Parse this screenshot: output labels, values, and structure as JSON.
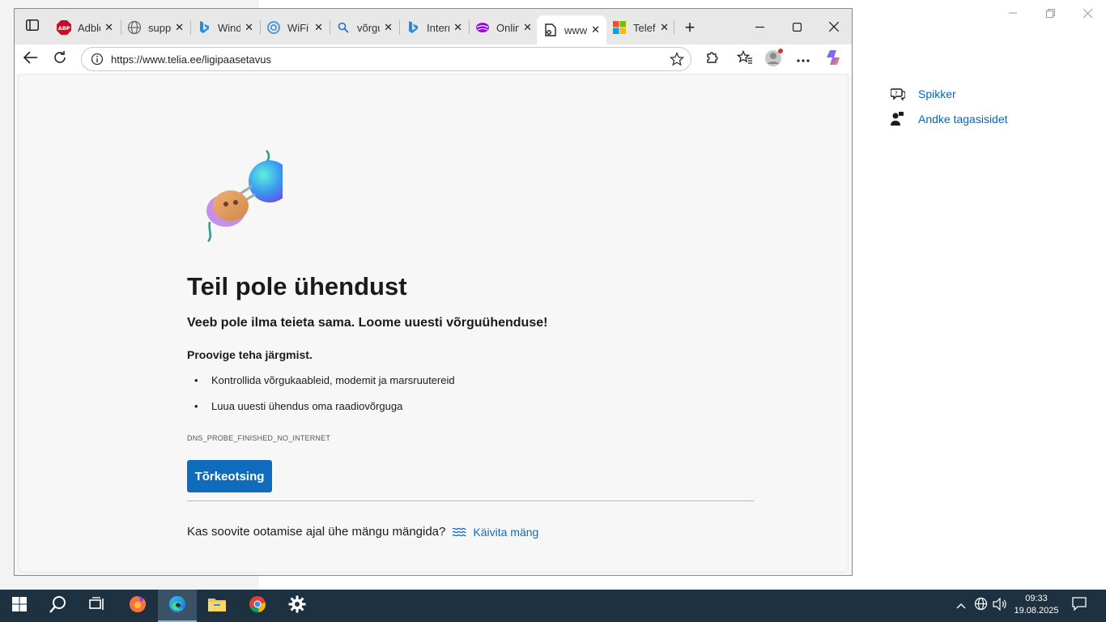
{
  "settings_panel": {
    "links": [
      {
        "label": "Spikker",
        "icon": "help-chat-icon"
      },
      {
        "label": "Andke tagasisidet",
        "icon": "feedback-person-icon"
      }
    ]
  },
  "browser": {
    "tabs": [
      {
        "title": "Adblock",
        "icon": "adblock-icon"
      },
      {
        "title": "support",
        "icon": "globe-icon"
      },
      {
        "title": "Windows",
        "icon": "bing-icon"
      },
      {
        "title": "WiFi",
        "icon": "wifi-site-icon"
      },
      {
        "title": "võrgu",
        "icon": "search-icon"
      },
      {
        "title": "Internet",
        "icon": "bing-icon"
      },
      {
        "title": "Online",
        "icon": "telia-icon"
      },
      {
        "title": "www.telia.ee",
        "icon": "page-error-icon",
        "active": true
      },
      {
        "title": "Telefon",
        "icon": "microsoft-icon"
      }
    ],
    "address_url": "https://www.telia.ee/ligipaasetavus",
    "error_page": {
      "title": "Teil pole ühendust",
      "subtitle": "Veeb pole ilma teieta sama. Loome uuesti võrguühenduse!",
      "try_heading": "Proovige teha järgmist.",
      "suggestions": [
        "Kontrollida võrgukaableid, modemit ja marsruutereid",
        "Luua uuesti ühendus oma raadiovõrguga"
      ],
      "error_code": "DNS_PROBE_FINISHED_NO_INTERNET",
      "troubleshoot_button": "Tõrkeotsing",
      "game_prompt": "Kas soovite ootamise ajal ühe mängu mängida?",
      "game_link": "Käivita mäng"
    }
  },
  "taskbar": {
    "time": "09:33",
    "date": "19.08.2025"
  },
  "colors": {
    "accent": "#0f6cbd",
    "taskbar": "#1e3140",
    "link": "#0067c0"
  }
}
